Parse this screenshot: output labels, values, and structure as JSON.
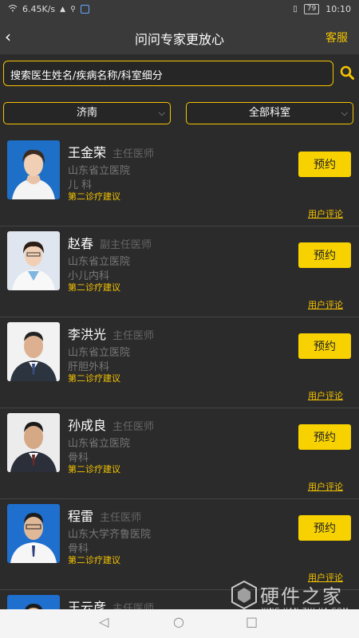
{
  "status": {
    "speed": "6.45K/s",
    "battery": "79",
    "time": "10:10"
  },
  "nav": {
    "title": "问问专家更放心",
    "service": "客服"
  },
  "search": {
    "placeholder": "搜索医生姓名/疾病名称/科室细分"
  },
  "filters": {
    "city": "济南",
    "dept": "全部科室"
  },
  "doctors": [
    {
      "name": "王金荣",
      "title": "主任医师",
      "hospital": "山东省立医院",
      "dept": "儿 科",
      "second": "第二诊疗建议",
      "book": "预约",
      "review": "用户评论"
    },
    {
      "name": "赵春",
      "title": "副主任医师",
      "hospital": "山东省立医院",
      "dept": "小儿内科",
      "second": "第二诊疗建议",
      "book": "预约",
      "review": "用户评论"
    },
    {
      "name": "李洪光",
      "title": "主任医师",
      "hospital": "山东省立医院",
      "dept": "肝胆外科",
      "second": "第二诊疗建议",
      "book": "预约",
      "review": "用户评论"
    },
    {
      "name": "孙成良",
      "title": "主任医师",
      "hospital": "山东省立医院",
      "dept": "骨科",
      "second": "第二诊疗建议",
      "book": "预约",
      "review": "用户评论"
    },
    {
      "name": "程雷",
      "title": "主任医师",
      "hospital": "山东大学齐鲁医院",
      "dept": "骨科",
      "second": "第二诊疗建议",
      "book": "预约",
      "review": "用户评论"
    },
    {
      "name": "王云彦",
      "title": "主任医师"
    }
  ],
  "watermark": {
    "brand": "硬件之家",
    "url": "YING JIAN ZHI JIA.COM"
  },
  "colors": {
    "accent": "#f5c400",
    "button": "#f7d200",
    "bg": "#2b2b2b"
  }
}
